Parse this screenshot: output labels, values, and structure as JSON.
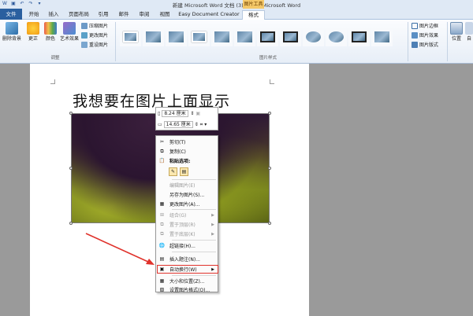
{
  "window": {
    "title": "新建 Microsoft Word 文档 (3).docx - Microsoft Word",
    "context_tab_group": "图片工具"
  },
  "tabs": [
    {
      "label": "文件"
    },
    {
      "label": "开始"
    },
    {
      "label": "插入"
    },
    {
      "label": "页面布局"
    },
    {
      "label": "引用"
    },
    {
      "label": "邮件"
    },
    {
      "label": "审阅"
    },
    {
      "label": "视图"
    },
    {
      "label": "Easy Document Creator"
    },
    {
      "label": "格式"
    }
  ],
  "ribbon": {
    "remove_bg": "删除背景",
    "corrections": "更正",
    "color": "颜色",
    "artistic": "艺术效果",
    "compress": "压缩图片",
    "change": "更改图片",
    "reset": "重设图片",
    "group_adjust": "调整",
    "group_styles": "图片样式",
    "border": "图片边框",
    "effects": "图片效果",
    "layout": "图片版式",
    "position": "位置",
    "wrap": "自"
  },
  "document": {
    "heading": "我想要在图片上面显示"
  },
  "size_bar": {
    "height": "8.24 厘米",
    "width": "14.65 厘米"
  },
  "context_menu": {
    "items": [
      {
        "label": "剪切(T)",
        "disabled": false
      },
      {
        "label": "复制(C)",
        "disabled": false
      },
      {
        "label": "粘贴选项:",
        "disabled": false
      },
      {
        "label": "编辑图片(E)",
        "disabled": true
      },
      {
        "label": "另存为图片(S)...",
        "disabled": false
      },
      {
        "label": "更改图片(A)...",
        "disabled": false
      },
      {
        "label": "组合(G)",
        "disabled": true
      },
      {
        "label": "置于顶层(R)",
        "disabled": true
      },
      {
        "label": "置于底层(K)",
        "disabled": true
      },
      {
        "label": "超链接(H)...",
        "disabled": false
      },
      {
        "label": "插入题注(N)...",
        "disabled": false
      },
      {
        "label": "自动换行(W)",
        "disabled": false
      },
      {
        "label": "大小和位置(Z)...",
        "disabled": false
      },
      {
        "label": "设置图片格式(O)...",
        "disabled": false
      }
    ]
  },
  "colors": {
    "file_tab": "#2a5f9f",
    "context_tab": "#f4c869",
    "highlight": "#e0322b"
  }
}
